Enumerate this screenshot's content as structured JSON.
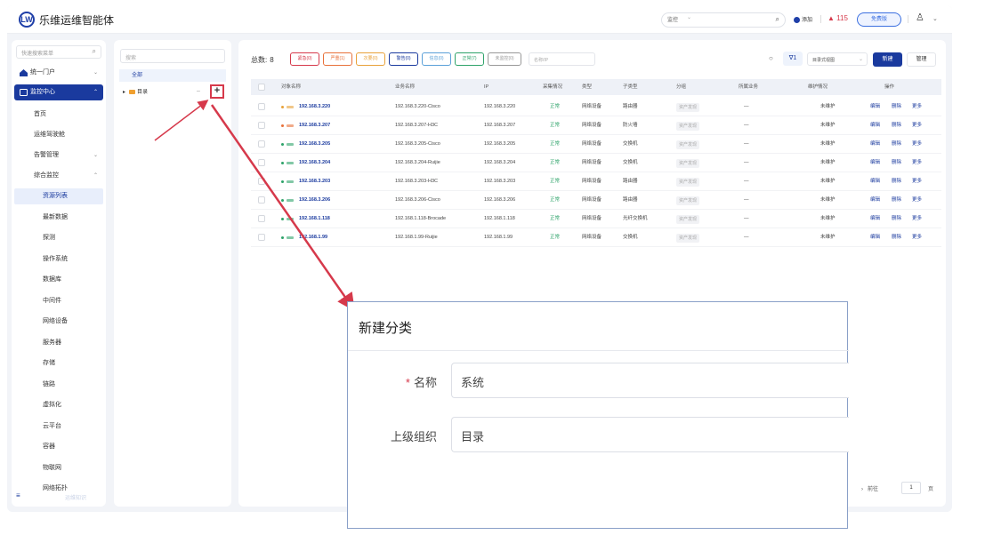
{
  "header": {
    "brand": "乐维运维智能体",
    "logo_text": "LW",
    "search_select": "监控",
    "add_label": "添加",
    "alert_count": "115",
    "free_badge": "免费版"
  },
  "sidebar": {
    "search_placeholder": "快速搜索菜单",
    "portal": "统一门户",
    "monitor_center": "监控中心",
    "items": [
      "首页",
      "运维驾驶舱",
      "告警管理",
      "综合监控"
    ],
    "sub_items": [
      "资源列表",
      "最新数据",
      "探测",
      "操作系统",
      "数据库",
      "中间件",
      "网络设备",
      "服务器",
      "存储",
      "链路",
      "虚拟化",
      "云平台",
      "容器",
      "物联网",
      "网络拓扑"
    ],
    "bottom_text": "运维知识"
  },
  "tree": {
    "search_placeholder": "搜索",
    "all": "全部",
    "node": "目录",
    "add_symbol": "+"
  },
  "toolbar": {
    "total_label": "总数:",
    "total_value": "8",
    "filters": [
      {
        "label": "紧急(0)",
        "color": "#d6394b"
      },
      {
        "label": "严重(1)",
        "color": "#e8713a"
      },
      {
        "label": "次要(0)",
        "color": "#e8a23a"
      },
      {
        "label": "警告(0)",
        "color": "#1a3a9e"
      },
      {
        "label": "信息(0)",
        "color": "#5aa0d8"
      },
      {
        "label": "正常(7)",
        "color": "#2ea36a"
      },
      {
        "label": "未监控(0)",
        "color": "#999999"
      }
    ],
    "name_search_placeholder": "名称/IP",
    "funnel_count": "1",
    "view_select": "目录式视图",
    "new_button": "新建",
    "manage_button": "管理"
  },
  "table": {
    "headers": [
      "对象名称",
      "业务名称",
      "IP",
      "采集情况",
      "类型",
      "子类型",
      "分组",
      "所属业务",
      "维护情况",
      "操作"
    ],
    "rows": [
      {
        "name": "192.168.3.220",
        "biz": "192.168.3.220-Cisco",
        "ip": "192.168.3.220",
        "status": "正常",
        "type": "网络设备",
        "subtype": "路由器",
        "group": "资产发现",
        "owner": "—",
        "maint": "未维护",
        "dot": "#e8a23a"
      },
      {
        "name": "192.168.3.207",
        "biz": "192.168.3.207-H3C",
        "ip": "192.168.3.207",
        "status": "正常",
        "type": "网络设备",
        "subtype": "防火墙",
        "group": "资产发现",
        "owner": "—",
        "maint": "未维护",
        "dot": "#e8713a"
      },
      {
        "name": "192.168.3.205",
        "biz": "192.168.3.205-Cisco",
        "ip": "192.168.3.205",
        "status": "正常",
        "type": "网络设备",
        "subtype": "交换机",
        "group": "资产发现",
        "owner": "—",
        "maint": "未维护",
        "dot": "#2ea36a"
      },
      {
        "name": "192.168.3.204",
        "biz": "192.168.3.204-Ruijie",
        "ip": "192.168.3.204",
        "status": "正常",
        "type": "网络设备",
        "subtype": "交换机",
        "group": "资产发现",
        "owner": "—",
        "maint": "未维护",
        "dot": "#2ea36a"
      },
      {
        "name": "192.168.3.203",
        "biz": "192.168.3.203-H3C",
        "ip": "192.168.3.203",
        "status": "正常",
        "type": "网络设备",
        "subtype": "路由器",
        "group": "资产发现",
        "owner": "—",
        "maint": "未维护",
        "dot": "#2ea36a"
      },
      {
        "name": "192.168.3.206",
        "biz": "192.168.3.206-Cisco",
        "ip": "192.168.3.206",
        "status": "正常",
        "type": "网络设备",
        "subtype": "路由器",
        "group": "资产发现",
        "owner": "—",
        "maint": "未维护",
        "dot": "#2ea36a"
      },
      {
        "name": "192.168.1.118",
        "biz": "192.168.1.118-Brocade",
        "ip": "192.168.1.118",
        "status": "正常",
        "type": "网络设备",
        "subtype": "光纤交换机",
        "group": "资产发现",
        "owner": "—",
        "maint": "未维护",
        "dot": "#2ea36a"
      },
      {
        "name": "192.168.1.99",
        "biz": "192.168.1.99-Ruijie",
        "ip": "192.168.1.99",
        "status": "正常",
        "type": "网络设备",
        "subtype": "交换机",
        "group": "资产发现",
        "owner": "—",
        "maint": "未维护",
        "dot": "#2ea36a"
      }
    ],
    "ops": [
      "编辑",
      "删除",
      "更多"
    ]
  },
  "pager": {
    "prefix": "前往",
    "page": "1",
    "suffix": "页"
  },
  "dialog": {
    "title": "新建分类",
    "name_label": "名称",
    "name_value": "系统",
    "parent_label": "上级组织",
    "parent_value": "目录"
  },
  "colors": {
    "accent": "#1a3a9e",
    "annotation": "#d6394b"
  }
}
